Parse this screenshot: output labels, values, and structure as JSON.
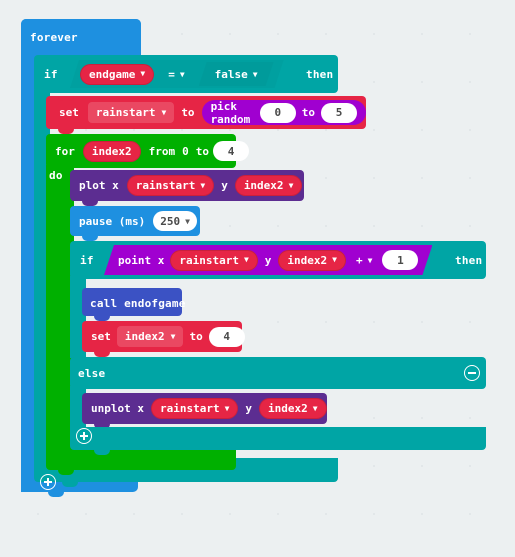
{
  "app": {
    "name": "makecode-blocks-editor",
    "workspace": "micro:bit blocks workspace"
  },
  "colors": {
    "event": "#1E90E0",
    "logic": "#00A5A5",
    "loop": "#00B000",
    "variable": "#E62545",
    "math": "#A000D0",
    "led": "#5C2D91",
    "basic": "#1E90E0",
    "function": "#3B52C4",
    "field_white": "#FFFFFF",
    "canvas": "#ECF0F1"
  },
  "program": {
    "forever": {
      "label": "forever"
    },
    "outer_if": {
      "if_label": "if",
      "then_label": "then",
      "condition": {
        "left": "endgame",
        "operator": "=",
        "right": "false"
      }
    },
    "set_rainstart": {
      "set_label": "set",
      "variable": "rainstart",
      "to_label": "to",
      "value": {
        "op_label": "pick random",
        "from": "0",
        "to_label": "to",
        "to": "5"
      }
    },
    "for_loop": {
      "for_label": "for",
      "index": "index2",
      "from_label": "from",
      "from": "0",
      "to_label": "to",
      "to": "4",
      "do_label": "do"
    },
    "plot": {
      "label": "plot x",
      "x": "rainstart",
      "y_label": "y",
      "y": "index2"
    },
    "pause": {
      "label": "pause (ms)",
      "value": "250"
    },
    "inner_if": {
      "if_label": "if",
      "then_label": "then",
      "else_label": "else",
      "condition": {
        "label": "point x",
        "x": "rainstart",
        "y_label": "y",
        "y_term": "index2",
        "operator": "+",
        "operand": "1"
      }
    },
    "call_endofgame": {
      "label": "call endofgame"
    },
    "set_index2": {
      "set_label": "set",
      "variable": "index2",
      "to_label": "to",
      "value": "4"
    },
    "unplot": {
      "label": "unplot x",
      "x": "rainstart",
      "y_label": "y",
      "y": "index2"
    }
  },
  "icons": {
    "inner_collapse": "minus-circle-icon",
    "inner_expand": "plus-circle-icon",
    "outer_expand": "plus-circle-icon"
  }
}
